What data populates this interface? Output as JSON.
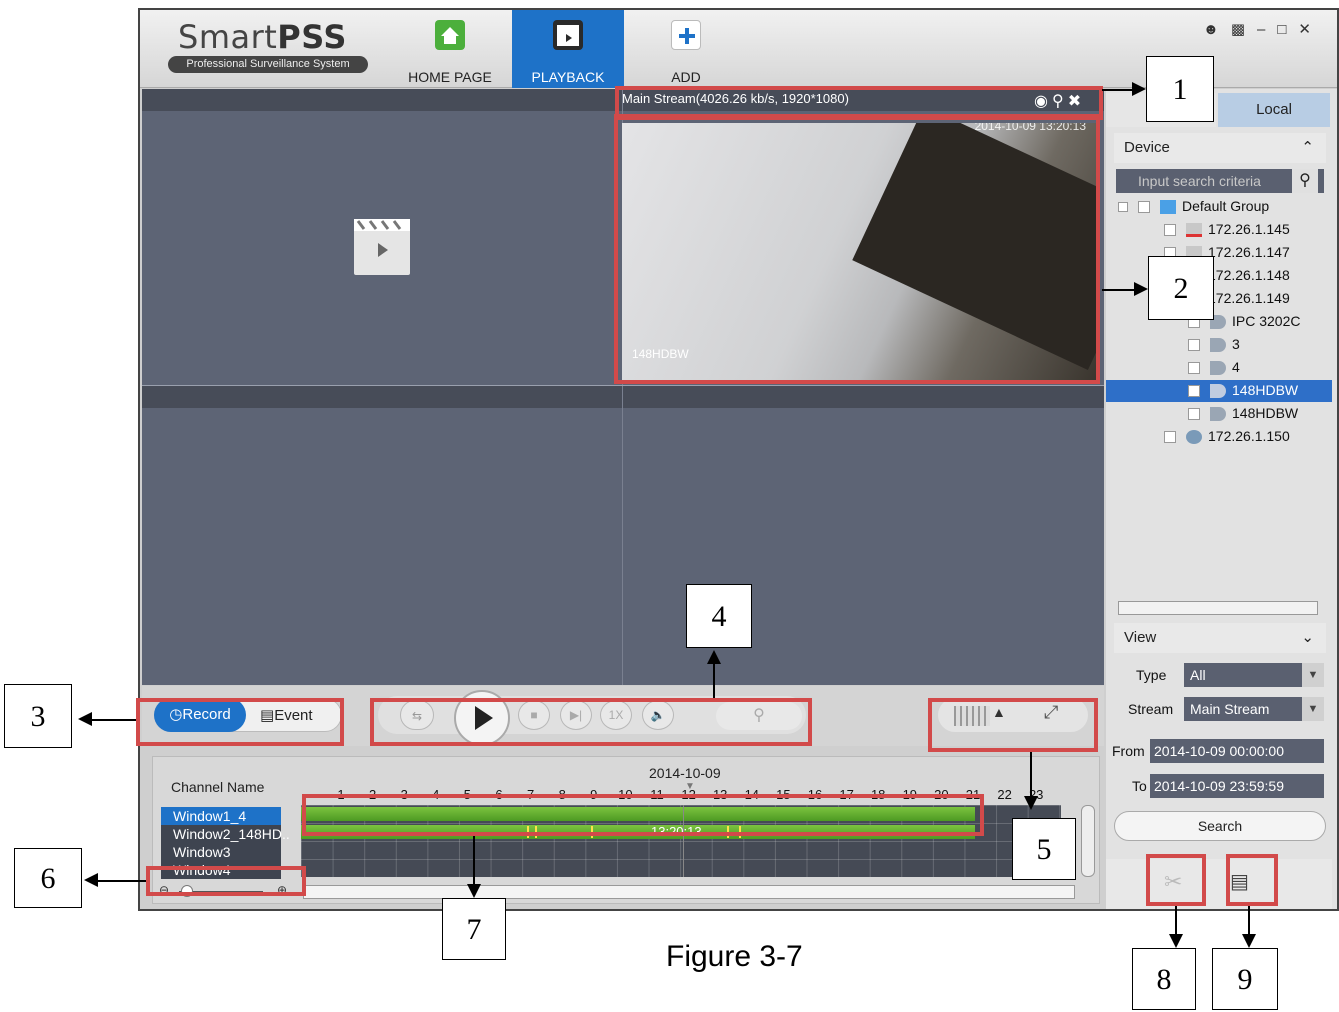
{
  "app": {
    "brand": "SmartPSS",
    "brand_light": "Smart",
    "brand_bold": "PSS",
    "subtitle": "Professional Surveillance System",
    "nav": [
      {
        "label": "HOME PAGE"
      },
      {
        "label": "PLAYBACK"
      },
      {
        "label": "ADD"
      }
    ]
  },
  "video": {
    "stream_info": "Main Stream(4026.26 kb/s, 1920*1080)",
    "timestamp": "2014-10-09 13:20:13",
    "camera_label": "148HDBW"
  },
  "controls": {
    "record_label": "Record",
    "event_label": "Event",
    "speed_label": "1X"
  },
  "timeline": {
    "date": "2014-10-09",
    "channel_header": "Channel Name",
    "hours": [
      "1",
      "2",
      "3",
      "4",
      "5",
      "6",
      "7",
      "8",
      "9",
      "10",
      "11",
      "12",
      "13",
      "14",
      "15",
      "16",
      "17",
      "18",
      "19",
      "20",
      "21",
      "22",
      "23"
    ],
    "channels": [
      "Window1_4",
      "Window2_148HD..",
      "Window3",
      "Window4"
    ],
    "cursor_time": "13:20:13"
  },
  "side": {
    "tab_device": "D",
    "tab_local": "Local",
    "device_section": "Device",
    "search_placeholder": "Input search criteria",
    "tree": [
      {
        "label": "Default Group"
      },
      {
        "label": "172.26.1.145"
      },
      {
        "label": "172.26.1.147"
      },
      {
        "label": "172.26.1.148"
      },
      {
        "label": "172.26.1.149"
      },
      {
        "label": "IPC 3202C"
      },
      {
        "label": "3"
      },
      {
        "label": "4"
      },
      {
        "label": "148HDBW"
      },
      {
        "label": "148HDBW"
      },
      {
        "label": "172.26.1.150"
      }
    ],
    "view_section": "View",
    "type_label": "Type",
    "type_value": "All",
    "stream_label": "Stream",
    "stream_value": "Main Stream",
    "from_label": "From",
    "from_value": "2014-10-09 00:00:00",
    "to_label": "To",
    "to_value": "2014-10-09 23:59:59",
    "search_button": "Search"
  },
  "callouts": [
    "1",
    "2",
    "3",
    "4",
    "5",
    "6",
    "7",
    "8",
    "9"
  ],
  "caption": "Figure 3-7"
}
